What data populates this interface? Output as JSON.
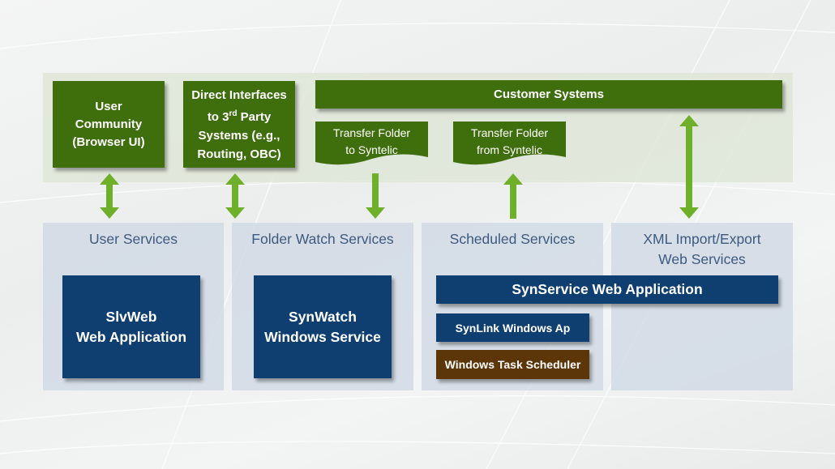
{
  "top": {
    "user_community": "User Community (Browser UI)",
    "direct_interfaces_line1": "Direct Interfaces",
    "direct_interfaces_line2_pre": "to 3",
    "direct_interfaces_sup": "rd",
    "direct_interfaces_line2_post": " Party",
    "direct_interfaces_line3": "Systems (e.g.,",
    "direct_interfaces_line4": "Routing, OBC)",
    "customer_systems": "Customer Systems",
    "transfer_to_line1": "Transfer  Folder",
    "transfer_to_line2": "to Syntelic",
    "transfer_from_line1": "Transfer  Folder",
    "transfer_from_line2": "from Syntelic"
  },
  "columns": {
    "user_services": "User Services",
    "folder_watch_services": "Folder Watch Services",
    "scheduled_services": "Scheduled Services",
    "xml_line1": "XML Import/Export",
    "xml_line2": "Web Services"
  },
  "components": {
    "slvweb_line1": "SlvWeb",
    "slvweb_line2": "Web Application",
    "synwatch_line1": "SynWatch",
    "synwatch_line2": "Windows Service",
    "synservice": "SynService Web Application",
    "synlink": "SynLink Windows Ap",
    "task_scheduler": "Windows Task Scheduler"
  },
  "colors": {
    "green_box": "#3f6e0c",
    "arrow_green": "#6fb02a",
    "blue_box": "#0f3f70",
    "brown_box": "#5c3508"
  },
  "arrows": [
    {
      "name": "user-community-arrow",
      "direction": "both"
    },
    {
      "name": "direct-interfaces-arrow",
      "direction": "both"
    },
    {
      "name": "transfer-to-arrow",
      "direction": "down"
    },
    {
      "name": "transfer-from-arrow",
      "direction": "up"
    },
    {
      "name": "customer-systems-arrow",
      "direction": "both"
    }
  ]
}
